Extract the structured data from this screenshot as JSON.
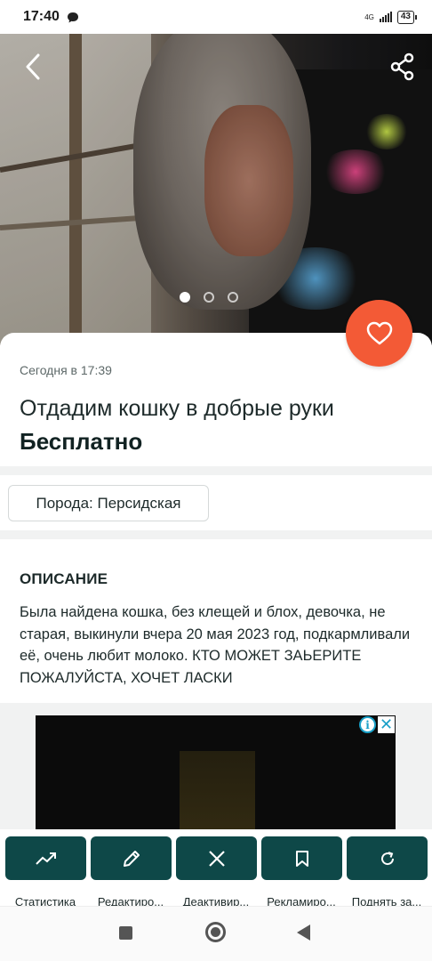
{
  "status_bar": {
    "time": "17:40",
    "network": "4G",
    "battery": "43"
  },
  "gallery": {
    "image_count": 3,
    "active_index": 0
  },
  "listing": {
    "date": "Сегодня в 17:39",
    "title": "Отдадим кошку в добрые руки",
    "price": "Бесплатно",
    "breed_chip": "Порода: Персидская"
  },
  "description": {
    "heading": "ОПИСАНИЕ",
    "text": "Была найдена кошка, без клещей и блох, девочка, не старая, выкинули вчера 20 мая 2023 год, подкармливали её, очень любит молоко. КТО МОЖЕТ ЗАЬЕРИТЕ ПОЖАЛУЙСТА, ХОЧЕТ ЛАСКИ"
  },
  "ad": {
    "info_glyph": "i",
    "close_glyph": "✕"
  },
  "actions": [
    {
      "label": "Статистика",
      "icon": "trending-up-icon"
    },
    {
      "label": "Редактиро...",
      "icon": "pencil-icon"
    },
    {
      "label": "Деактивир...",
      "icon": "close-icon"
    },
    {
      "label": "Рекламиро...",
      "icon": "bookmark-icon"
    },
    {
      "label": "Поднять за...",
      "icon": "refresh-icon"
    }
  ],
  "colors": {
    "accent": "#f35a36",
    "action_button": "#0e4848",
    "text": "#1d2a2a"
  }
}
